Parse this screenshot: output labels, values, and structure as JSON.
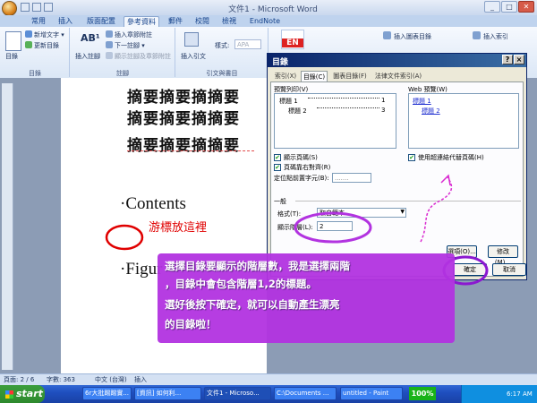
{
  "window": {
    "title": "文件1 - Microsoft Word",
    "controls": [
      "_",
      "□",
      "✕"
    ]
  },
  "ribbon": {
    "tabs": [
      {
        "label": "常用"
      },
      {
        "label": "插入"
      },
      {
        "label": "版面配置"
      },
      {
        "label": "參考資料"
      },
      {
        "label": "郵件"
      },
      {
        "label": "校閱"
      },
      {
        "label": "檢視"
      },
      {
        "label": "EndNote"
      }
    ],
    "active_tab": "參考資料",
    "toc_group": {
      "main_label": "目錄",
      "items": [
        "新增文字 ▾",
        "更新目錄"
      ],
      "group_label": "目錄"
    },
    "footnote_group": {
      "insert_label": "插入註腳",
      "items": [
        "插入章節附註",
        "下一註腳 ▾",
        "顯示註腳及章節附註"
      ],
      "group_label": "註腳"
    },
    "citation_group": {
      "insert_label": "插入引文",
      "style_label": "樣式:",
      "style_value": "APA",
      "group_label": "引文與書目"
    },
    "right_group_items": [
      "插入圖表目錄",
      "插入索引"
    ]
  },
  "document": {
    "repeated_line": "摘要摘要摘摘要",
    "contents_heading": "·Contents",
    "cursor_note": "游標放這裡",
    "figure_heading": "·Figur"
  },
  "dialog": {
    "title": "目錄",
    "tabs": [
      "索引(X)",
      "目錄(C)",
      "圖表目錄(F)",
      "法律文件索引(A)"
    ],
    "print_preview": {
      "label": "預覽列印(V)",
      "entries": [
        {
          "text": "標題 1",
          "page": "1"
        },
        {
          "text": "標題 2",
          "page": "3"
        }
      ]
    },
    "web_preview": {
      "label": "Web 預覽(W)",
      "entries": [
        "標題 1",
        "標題 2"
      ]
    },
    "options": {
      "show_page_numbers": "顯示頁碼(S)",
      "right_align": "頁碼靠右對齊(R)",
      "tab_leader_label": "定位點前置字元(B):",
      "tab_leader_value": ".......",
      "use_hyperlinks": "使用超連結代替頁碼(H)"
    },
    "general": {
      "section_label": "一般",
      "format_label": "格式(T):",
      "format_value": "取自範本",
      "levels_label": "顯示階層(L):",
      "levels_value": "2"
    },
    "buttons": {
      "options": "選項(O)...",
      "modify": "修改(M)...",
      "ok": "確定",
      "cancel": "取消"
    }
  },
  "annotation": {
    "lines": [
      "選擇目錄要顯示的階層數，我是選擇兩階",
      "，目錄中會包含階層1,2的標題。",
      "選好後按下確定，就可以自動產生漂亮",
      "的目錄啦！"
    ]
  },
  "statusbar": {
    "page": "頁面: 2 / 6",
    "words": "字數: 363",
    "language": "中文 (台灣)",
    "mode": "插入"
  },
  "taskbar": {
    "start": "start",
    "tasks": [
      "6r大批踢踢實...",
      "[資訊] 如何利...",
      "文件1 - Microso...",
      "C:\\Documents ...",
      "untitled - Paint"
    ],
    "zoom": "100%",
    "clock": "6:17 AM"
  },
  "colors": {
    "accent_purple": "#b233e0",
    "cursor_note_red": "#e00000",
    "dialog_title_blue": "#0a246a"
  }
}
